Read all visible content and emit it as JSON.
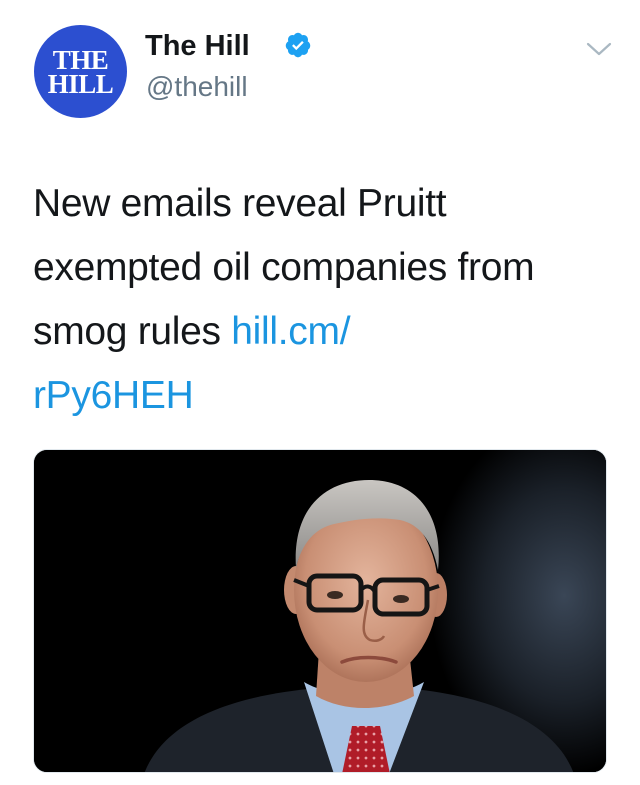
{
  "account": {
    "avatar_line1": "THE",
    "avatar_line2": "HILL",
    "display_name": "The Hill",
    "handle": "@thehill",
    "verified_icon": "verified-badge-icon",
    "menu_icon": "chevron-down-icon"
  },
  "tweet": {
    "text": "New emails reveal Pruitt exempted oil companies from smog rules ",
    "link_text_1": "hill.cm/",
    "link_text_2": "rPy6HEH"
  },
  "media": {
    "type": "photo"
  },
  "colors": {
    "avatar_bg": "#2c4fd0",
    "link": "#1b95e0",
    "verified": "#1da1f2",
    "secondary_text": "#657786"
  }
}
